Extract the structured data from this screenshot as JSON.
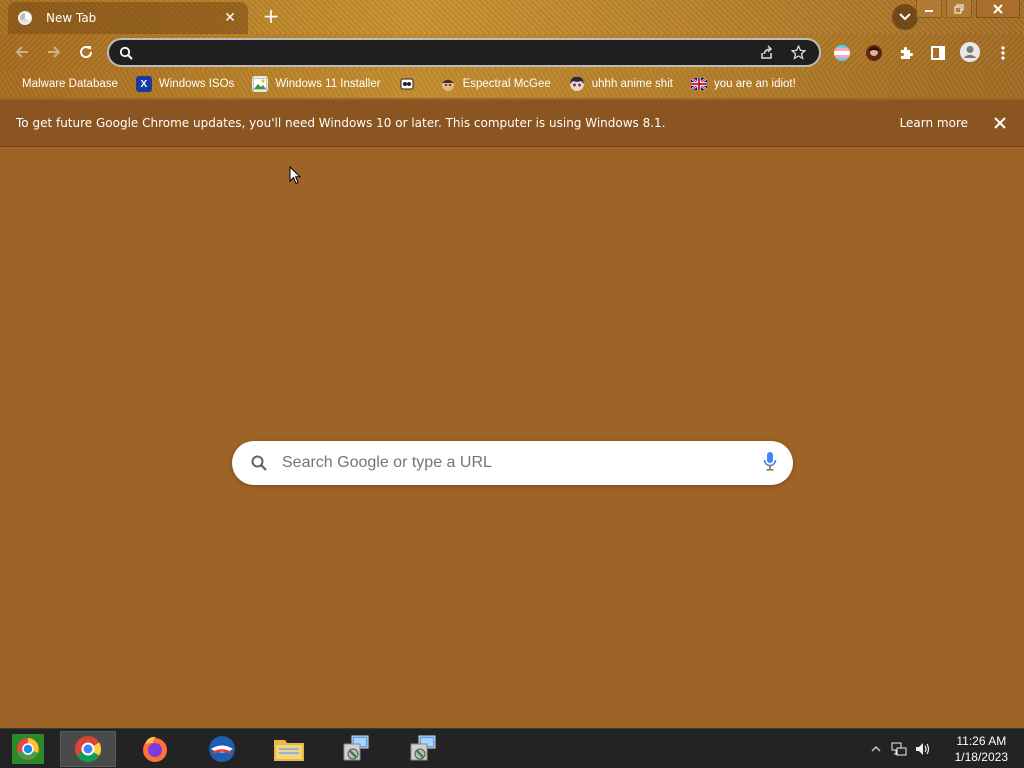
{
  "tab": {
    "title": "New Tab",
    "close_glyph": "✕"
  },
  "titlebar": {
    "new_tab_glyph": "+"
  },
  "toolbar": {
    "omnibox_value": "",
    "omnibox_icon": "search-icon",
    "extensions": [
      "trans-flag-extension",
      "avatar-extension",
      "puzzle-extensions-icon",
      "side-panel-icon",
      "profile-icon",
      "kebab-menu-icon"
    ]
  },
  "bookmarks": [
    {
      "label": "Malware Database",
      "icon": "none"
    },
    {
      "label": "Windows ISOs",
      "icon": "x-icon"
    },
    {
      "label": "Windows 11 Installer",
      "icon": "image-icon"
    },
    {
      "label": "",
      "icon": "tape-icon"
    },
    {
      "label": "Espectral McGee",
      "icon": "face-icon"
    },
    {
      "label": "uhhh anime shit",
      "icon": "anime-face-icon"
    },
    {
      "label": "you are an idiot!",
      "icon": "flag-icon"
    }
  ],
  "infobar": {
    "message": "To get future Google Chrome updates, you'll need Windows 10 or later. This computer is using Windows 8.1.",
    "learn_more": "Learn more"
  },
  "ntp": {
    "search_placeholder": "Search Google or type a URL"
  },
  "taskbar": {
    "items": [
      "start-button",
      "chrome",
      "firefox",
      "opera",
      "file-explorer",
      "setup-installer-1",
      "setup-installer-2"
    ]
  },
  "clock": {
    "time": "11:26 AM",
    "date": "1/18/2023"
  },
  "colors": {
    "page_bg": "#9e6326",
    "infobar_bg": "#8a5520",
    "omnibox_bg": "#1f1f1f",
    "taskbar_bg": "#232323",
    "mic_blue": "#4285f4"
  }
}
